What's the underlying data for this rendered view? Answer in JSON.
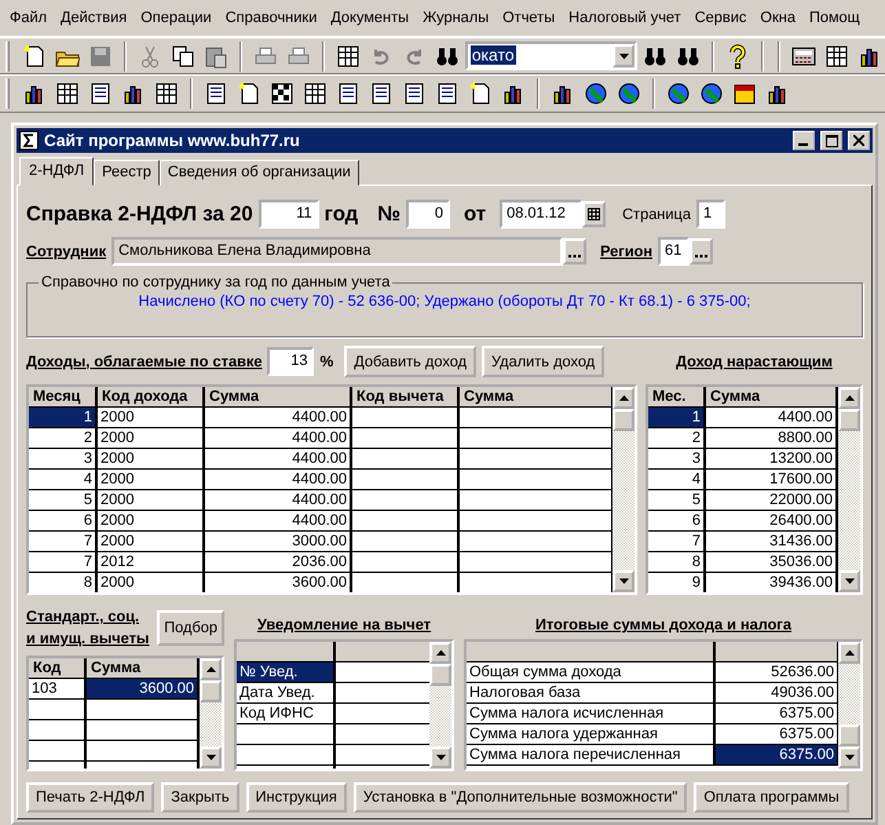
{
  "menu": [
    "Файл",
    "Действия",
    "Операции",
    "Справочники",
    "Документы",
    "Журналы",
    "Отчеты",
    "Налоговый учет",
    "Сервис",
    "Окна",
    "Помощ"
  ],
  "toolbar": {
    "search": {
      "value": "окато"
    }
  },
  "window": {
    "title": "Сайт программы www.buh77.ru"
  },
  "tabs": [
    {
      "label": "2-НДФЛ",
      "selected": true
    },
    {
      "label": "Реестр",
      "selected": false
    },
    {
      "label": "Сведения об организации",
      "selected": false
    }
  ],
  "header": {
    "title": "Справка 2-НДФЛ за 20",
    "year": "11",
    "year_label": "год",
    "number_label": "№",
    "number": "0",
    "date_label": "от",
    "date": "08.01.12",
    "page_label": "Страница",
    "page": "1"
  },
  "employee": {
    "label": "Сотрудник",
    "value": "Смольникова Елена Владимировна",
    "region_label": "Регион",
    "region": "61"
  },
  "reference": {
    "title": "Справочно по сотруднику за год по данным учета",
    "text": "Начислено (КО по счету 70) - 52 636-00; Удержано (обороты Дт 70 - Кт 68.1) - 6 375-00;"
  },
  "income": {
    "title": "Доходы, облагаемые по ставке",
    "rate": "13",
    "percent": "%",
    "buttons": [
      "Добавить доход",
      "Удалить доход"
    ],
    "columns": [
      "Месяц",
      "Код дохода",
      "Сумма",
      "Код вычета",
      "Сумма"
    ],
    "rows": [
      {
        "cells": [
          "1",
          "2000",
          "4400.00"
        ],
        "selected": true
      },
      {
        "cells": [
          "2",
          "2000",
          "4400.00"
        ],
        "selected": false
      },
      {
        "cells": [
          "3",
          "2000",
          "4400.00"
        ],
        "selected": false
      },
      {
        "cells": [
          "4",
          "2000",
          "4400.00"
        ],
        "selected": false
      },
      {
        "cells": [
          "5",
          "2000",
          "4400.00"
        ],
        "selected": false
      },
      {
        "cells": [
          "6",
          "2000",
          "4400.00"
        ],
        "selected": false
      },
      {
        "cells": [
          "7",
          "2000",
          "3000.00"
        ],
        "selected": false
      },
      {
        "cells": [
          "7",
          "2012",
          "2036.00"
        ],
        "selected": false
      },
      {
        "cells": [
          "8",
          "2000",
          "3600.00"
        ],
        "selected": false
      }
    ]
  },
  "cumulative": {
    "title": "Доход нарастающим",
    "columns": [
      "Мес.",
      "Сумма"
    ],
    "rows": [
      {
        "cells": [
          "1",
          "4400.00"
        ],
        "selected": true
      },
      {
        "cells": [
          "2",
          "8800.00"
        ],
        "selected": false
      },
      {
        "cells": [
          "3",
          "13200.00"
        ],
        "selected": false
      },
      {
        "cells": [
          "4",
          "17600.00"
        ],
        "selected": false
      },
      {
        "cells": [
          "5",
          "22000.00"
        ],
        "selected": false
      },
      {
        "cells": [
          "6",
          "26400.00"
        ],
        "selected": false
      },
      {
        "cells": [
          "7",
          "31436.00"
        ],
        "selected": false
      },
      {
        "cells": [
          "8",
          "35036.00"
        ],
        "selected": false
      },
      {
        "cells": [
          "9",
          "39436.00"
        ],
        "selected": false
      }
    ]
  },
  "deductions": {
    "title": "Стандарт., соц. и имущ. вычеты",
    "button": "Подбор",
    "columns": [
      "Код",
      "Сумма"
    ],
    "rows": [
      {
        "cells": [
          "103",
          "3600.00"
        ],
        "selected": true
      }
    ]
  },
  "notice": {
    "title": "Уведомление на вычет",
    "rows": [
      {
        "cells": [
          "№ Увед."
        ],
        "selected": true
      },
      {
        "cells": [
          "Дата Увед."
        ],
        "selected": false
      },
      {
        "cells": [
          "Код ИФНС"
        ],
        "selected": false
      }
    ]
  },
  "totals": {
    "title": "Итоговые суммы дохода и налога",
    "rows": [
      {
        "cells": [
          "Общая сумма дохода",
          "52636.00"
        ],
        "selected": false
      },
      {
        "cells": [
          "Налоговая база",
          "49036.00"
        ],
        "selected": false
      },
      {
        "cells": [
          "Сумма налога исчисленная",
          "6375.00"
        ],
        "selected": false
      },
      {
        "cells": [
          "Сумма налога удержанная",
          "6375.00"
        ],
        "selected": false
      },
      {
        "cells": [
          "Сумма налога перечисленная",
          "6375.00"
        ],
        "selected": true
      }
    ]
  },
  "footer_buttons": [
    "Печать 2-НДФЛ",
    "Закрыть",
    "Инструкция",
    "Установка в \"Дополнительные возможности\"",
    "Оплата программы"
  ]
}
